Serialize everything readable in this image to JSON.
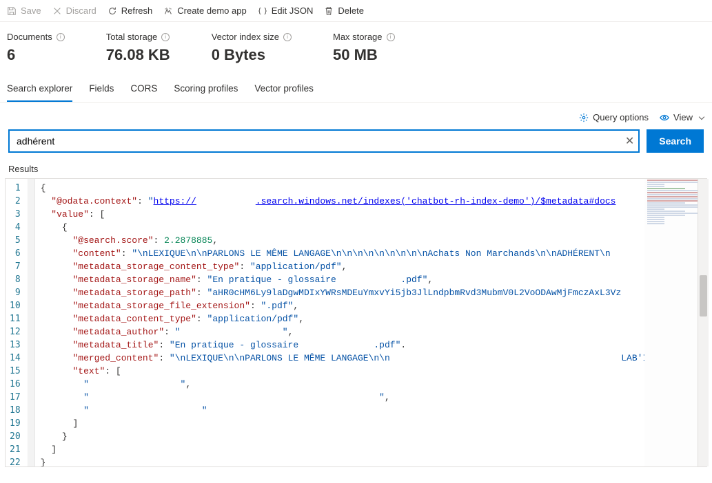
{
  "toolbar": {
    "save": "Save",
    "discard": "Discard",
    "refresh": "Refresh",
    "create_demo": "Create demo app",
    "edit_json": "Edit JSON",
    "delete": "Delete"
  },
  "stats": {
    "documents": {
      "label": "Documents",
      "value": "6"
    },
    "total_storage": {
      "label": "Total storage",
      "value": "76.08 KB"
    },
    "vector_index_size": {
      "label": "Vector index size",
      "value": "0 Bytes"
    },
    "max_storage": {
      "label": "Max storage",
      "value": "50 MB"
    }
  },
  "tabs": {
    "search_explorer": "Search explorer",
    "fields": "Fields",
    "cors": "CORS",
    "scoring_profiles": "Scoring profiles",
    "vector_profiles": "Vector profiles"
  },
  "actions": {
    "query_options": "Query options",
    "view": "View"
  },
  "search": {
    "value": "adhérent",
    "button": "Search"
  },
  "results_label": "Results",
  "json": {
    "odata_context_key": "@odata.context",
    "odata_context_prefix": "https://",
    "odata_context_suffix": ".search.windows.net/indexes('chatbot-rh-index-demo')/$metadata#docs",
    "value_key": "value",
    "search_score_key": "@search.score",
    "search_score_value": "2.2878885",
    "content_key": "content",
    "content_value": "\\nLEXIQUE\\n\\nPARLONS LE MÊME LANGAGE\\n\\n\\n\\n\\n\\n\\n\\n\\nAchats Non Marchands\\n\\nADHÉRENT\\n",
    "metadata_storage_content_type_key": "metadata_storage_content_type",
    "metadata_storage_content_type_value": "application/pdf",
    "metadata_storage_name_key": "metadata_storage_name",
    "metadata_storage_name_value": "En pratique - glossaire            .pdf",
    "metadata_storage_path_key": "metadata_storage_path",
    "metadata_storage_path_value": "aHR0cHM6Ly9laDgwMDIxYWRsMDEuYmxvYi5jb3JlLndpbmRvd3MubmV0L2VoODAwMjFmczAxL3Vz",
    "metadata_storage_file_extension_key": "metadata_storage_file_extension",
    "metadata_storage_file_extension_value": ".pdf",
    "metadata_content_type_key": "metadata_content_type",
    "metadata_content_type_value": "application/pdf",
    "metadata_author_key": "metadata_author",
    "metadata_author_value": "                   ",
    "metadata_title_key": "metadata_title",
    "metadata_title_value": "En pratique - glossaire              .pdf",
    "merged_content_key": "merged_content",
    "merged_content_value": "\\nLEXIQUE\\n\\nPARLONS LE MÊME LANGAGE\\n\\n                                           LAB'IN",
    "text_key": "text",
    "text_val1": "                 ",
    "text_val2": "                                                      ",
    "text_val3": "                     "
  }
}
